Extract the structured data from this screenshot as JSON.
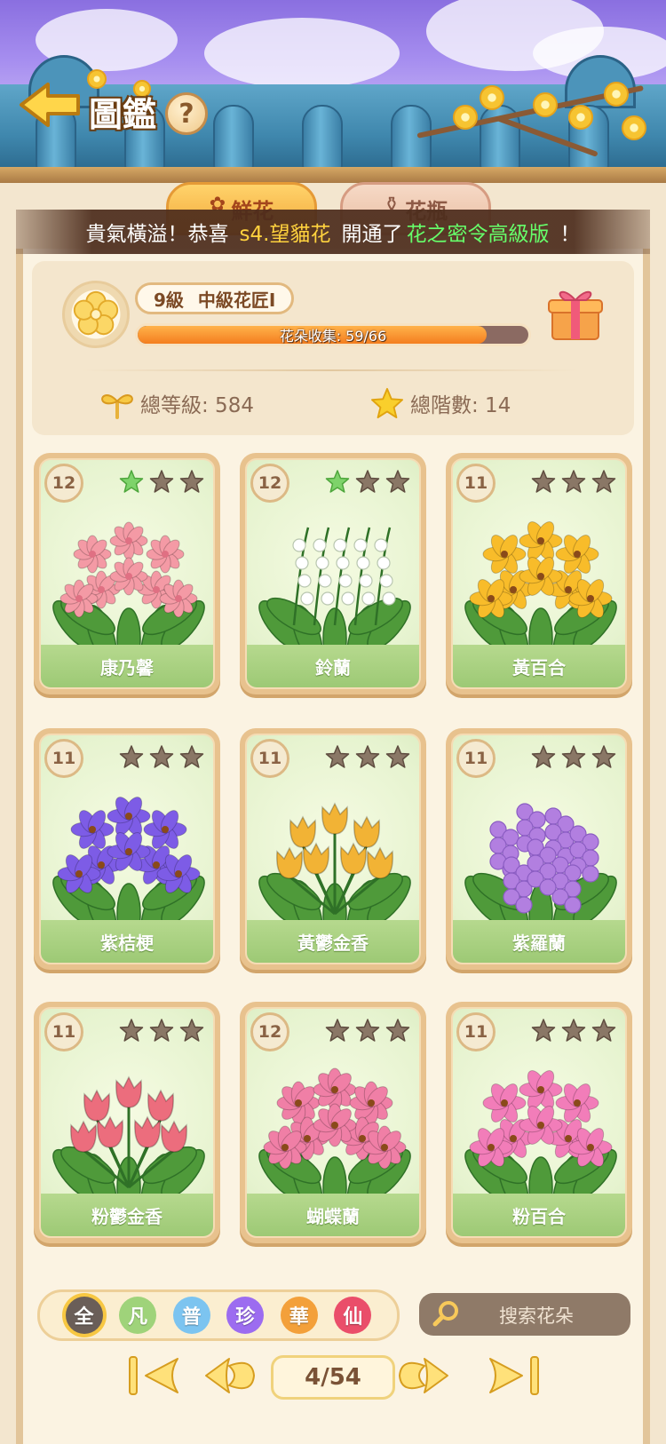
{
  "header": {
    "title": "圖鑑",
    "help_glyph": "?"
  },
  "tabs": [
    {
      "label": "鮮花",
      "icon": "flower-tab-icon",
      "active": true
    },
    {
      "label": "花瓶",
      "icon": "vase-tab-icon",
      "active": false
    }
  ],
  "banner": {
    "prefix": "貴氣橫溢！恭喜",
    "player": "s4.望貓花",
    "middle": "開通了",
    "item": "花之密令高級版",
    "suffix": "！"
  },
  "profile": {
    "level": "9級",
    "rank": "中級花匠I",
    "collection_text": "花朵收集: 59/66",
    "collection_fraction": 0.894,
    "total_level": "總等級: 584",
    "total_tier": "總階數: 14"
  },
  "cards": [
    {
      "level": "12",
      "stars_filled": 1,
      "name": "康乃馨",
      "color": "#f49aa5",
      "kind": "carnation"
    },
    {
      "level": "12",
      "stars_filled": 1,
      "name": "鈴蘭",
      "color": "#ffffff",
      "kind": "lily-of-valley"
    },
    {
      "level": "11",
      "stars_filled": 0,
      "name": "黃百合",
      "color": "#f8bc2a",
      "kind": "lily"
    },
    {
      "level": "11",
      "stars_filled": 0,
      "name": "紫桔梗",
      "color": "#7d5ce6",
      "kind": "bellflower"
    },
    {
      "level": "11",
      "stars_filled": 0,
      "name": "黃鬱金香",
      "color": "#f2b335",
      "kind": "tulip"
    },
    {
      "level": "11",
      "stars_filled": 0,
      "name": "紫羅蘭",
      "color": "#b27fe0",
      "kind": "stock"
    },
    {
      "level": "11",
      "stars_filled": 0,
      "name": "粉鬱金香",
      "color": "#ec6d7d",
      "kind": "tulip"
    },
    {
      "level": "12",
      "stars_filled": 0,
      "name": "蝴蝶蘭",
      "color": "#f07fa6",
      "kind": "orchid"
    },
    {
      "level": "11",
      "stars_filled": 0,
      "name": "粉百合",
      "color": "#f27db9",
      "kind": "lily"
    }
  ],
  "filters": [
    {
      "label": "全",
      "color": "#6a5e58",
      "selected": true
    },
    {
      "label": "凡",
      "color": "#9fd37a",
      "selected": false
    },
    {
      "label": "普",
      "color": "#7cc4f0",
      "selected": false
    },
    {
      "label": "珍",
      "color": "#9c6cf0",
      "selected": false
    },
    {
      "label": "華",
      "color": "#f3a03a",
      "selected": false
    },
    {
      "label": "仙",
      "color": "#ea4e6a",
      "selected": false
    }
  ],
  "search": {
    "placeholder": "搜索花朵"
  },
  "pager": {
    "label": "4/54"
  }
}
